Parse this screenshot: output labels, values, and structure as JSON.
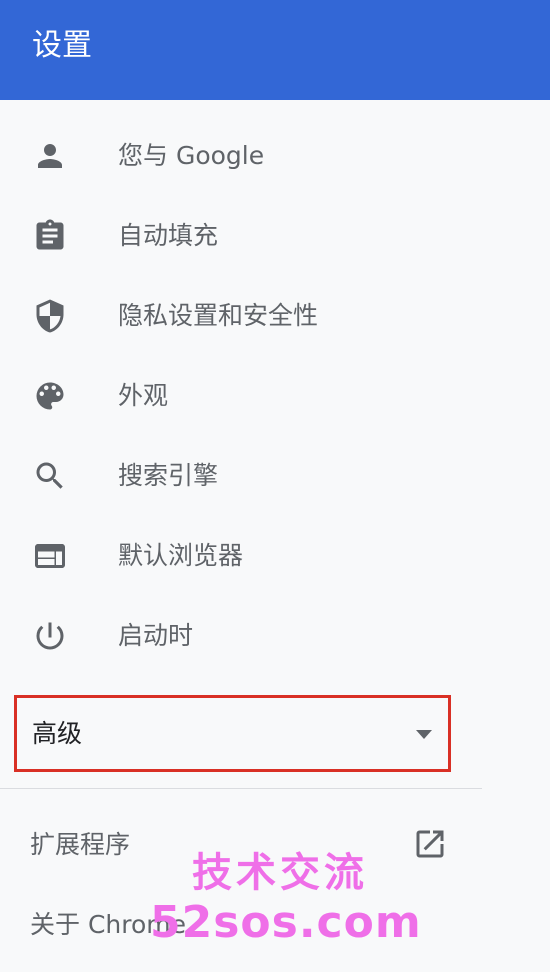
{
  "header": {
    "title": "设置"
  },
  "nav": {
    "items": [
      {
        "label": "您与 Google",
        "icon": "person-icon"
      },
      {
        "label": "自动填充",
        "icon": "clipboard-icon"
      },
      {
        "label": "隐私设置和安全性",
        "icon": "shield-icon"
      },
      {
        "label": "外观",
        "icon": "palette-icon"
      },
      {
        "label": "搜索引擎",
        "icon": "search-icon"
      },
      {
        "label": "默认浏览器",
        "icon": "browser-window-icon"
      },
      {
        "label": "启动时",
        "icon": "power-icon"
      }
    ]
  },
  "advanced": {
    "label": "高级",
    "icon": "caret-down-icon"
  },
  "bottom": {
    "extensions_label": "扩展程序",
    "extensions_icon": "open-in-new-icon",
    "about_label": "关于 Chrome"
  },
  "watermark": {
    "line1": "技术交流",
    "line2": "52sos.com"
  },
  "colors": {
    "header_bg": "#3367d6",
    "page_bg": "#f8f9fa",
    "icon_gray": "#5f6368",
    "highlight_border": "#d93025",
    "watermark": "#ef6fe8"
  }
}
